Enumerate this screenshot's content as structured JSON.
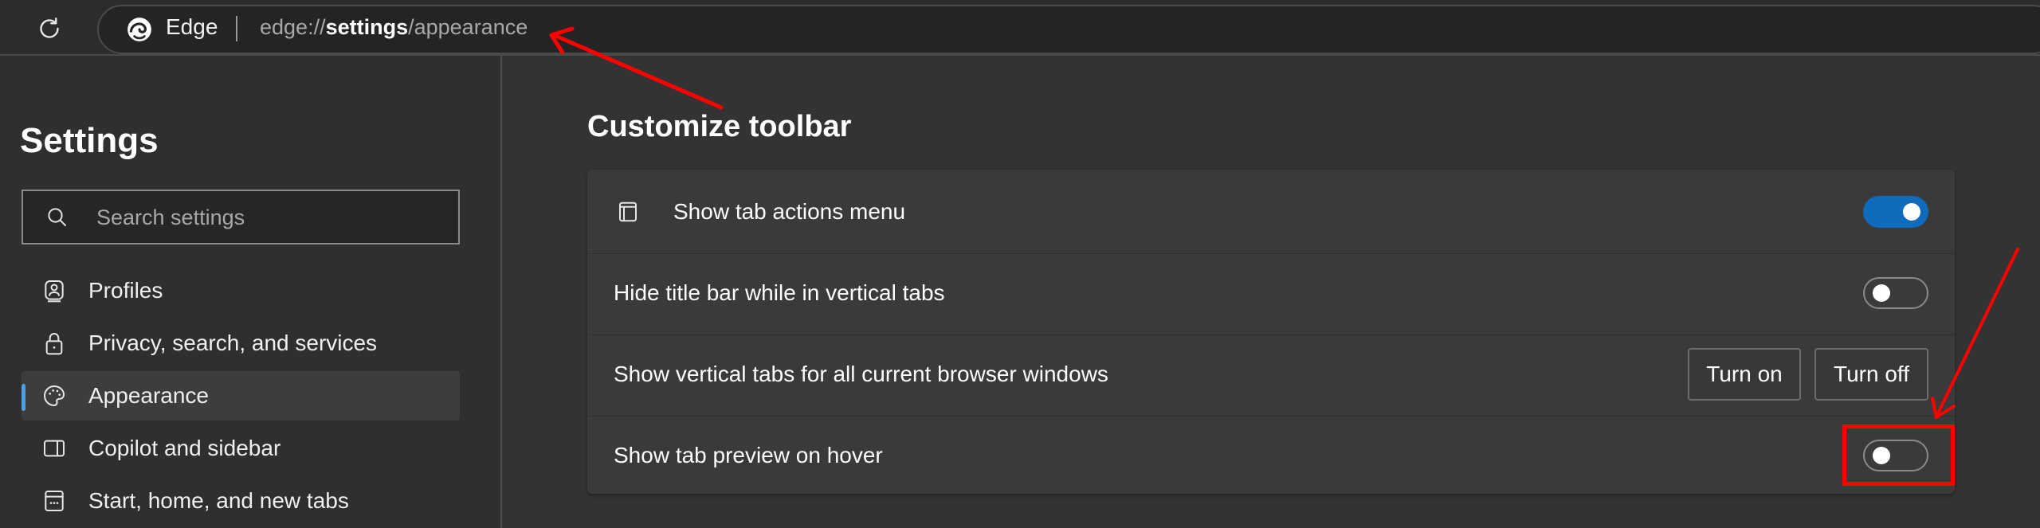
{
  "browser": {
    "reload_icon": "reload-icon",
    "brand_label": "Edge",
    "brand_icon": "edge-logo-icon",
    "url_prefix": "edge://",
    "url_bold": "settings",
    "url_suffix": "/appearance"
  },
  "sidebar": {
    "title": "Settings",
    "search": {
      "placeholder": "Search settings",
      "value": "",
      "icon": "search-icon"
    },
    "items": [
      {
        "label": "Profiles",
        "icon": "profile-icon",
        "active": false
      },
      {
        "label": "Privacy, search, and services",
        "icon": "lock-icon",
        "active": false
      },
      {
        "label": "Appearance",
        "icon": "palette-icon",
        "active": true
      },
      {
        "label": "Copilot and sidebar",
        "icon": "sidebar-panel-icon",
        "active": false
      },
      {
        "label": "Start, home, and new tabs",
        "icon": "new-tab-icon",
        "active": false
      }
    ]
  },
  "main": {
    "section_title": "Customize toolbar",
    "rows": [
      {
        "label": "Show tab actions menu",
        "icon": "tab-actions-icon",
        "control": "toggle",
        "state": "on"
      },
      {
        "label": "Hide title bar while in vertical tabs",
        "control": "toggle",
        "state": "off"
      },
      {
        "label": "Show vertical tabs for all current browser windows",
        "control": "buttons",
        "buttons": [
          "Turn on",
          "Turn off"
        ]
      },
      {
        "label": "Show tab preview on hover",
        "control": "toggle",
        "state": "off",
        "highlighted": true
      }
    ]
  },
  "colors": {
    "accent": "#0f6cbd",
    "active_indicator": "#4aa0ea",
    "annotation": "#ff0000"
  },
  "annotations": [
    {
      "type": "arrow",
      "points_to": "address-bar-url"
    },
    {
      "type": "arrow",
      "points_to": "tab-preview-toggle"
    },
    {
      "type": "box",
      "surrounds": "tab-preview-toggle"
    }
  ]
}
